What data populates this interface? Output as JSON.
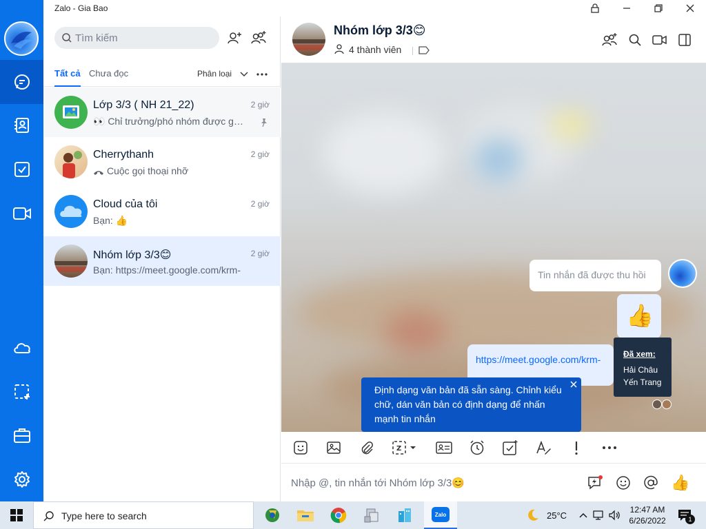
{
  "window": {
    "title": "Zalo - Gia Bao"
  },
  "search": {
    "placeholder": "Tìm kiếm"
  },
  "tabs": {
    "all": "Tất cả",
    "unread": "Chưa đọc",
    "classify": "Phân loại"
  },
  "conversations": [
    {
      "name": "Lớp 3/3 ( NH 21_22)",
      "preview": "👀 Chỉ trưởng/phó nhóm được gửi tin nhắn",
      "time": "2 giờ",
      "pinned": true
    },
    {
      "name": "Cherrythanh",
      "preview": "Cuộc gọi thoại nhỡ",
      "time": "2 giờ"
    },
    {
      "name": "Cloud của tôi",
      "preview": "Bạn: 👍",
      "time": "2 giờ"
    },
    {
      "name": "Nhóm lớp 3/3😊",
      "preview": "Bạn: https://meet.google.com/krm-",
      "time": "2 giờ",
      "selected": true
    }
  ],
  "chat": {
    "name": "Nhóm lớp 3/3😊",
    "members": "4 thành viên"
  },
  "messages": {
    "recalled": "Tin nhắn đã được thu hồi",
    "like": "👍",
    "link": "https://meet.google.com/krm-"
  },
  "seen": {
    "title": "Đã xem:",
    "names": [
      "Hải Châu",
      "Yến Trang"
    ]
  },
  "tip": {
    "text": "Định dạng văn bản đã sẵn sàng. Chỉnh kiểu chữ, dán văn bản có định dạng để nhấn mạnh tin nhắn"
  },
  "composer": {
    "placeholder": "Nhập @, tin nhắn tới Nhóm lớp 3/3😊",
    "like": "👍"
  },
  "taskbar": {
    "search": "Type here to search",
    "weather": "25°C",
    "time": "12:47 AM",
    "date": "6/26/2022",
    "notif_count": "1",
    "zalo_label": "Zalo"
  },
  "colors": {
    "brand": "#0a72e8",
    "accent": "#0a68ff",
    "tooltip": "#0a54c4"
  }
}
